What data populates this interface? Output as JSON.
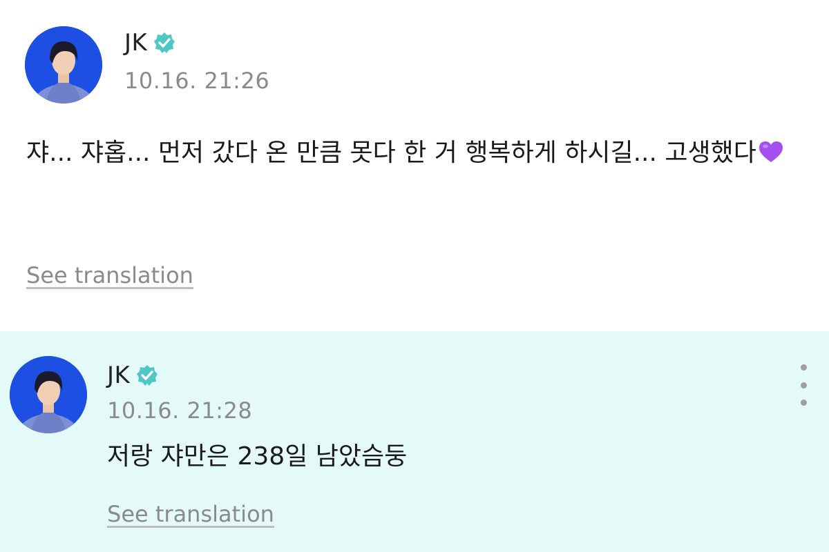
{
  "posts": [
    {
      "author": "JK",
      "timestamp": "10.16. 21:26",
      "text": "쟈... 쟈홉... 먼저 갔다 온 만큼 못다 한 거 행복하게 하시길... 고생했다",
      "emoji": "purple-heart",
      "see_translation": "See translation"
    },
    {
      "author": "JK",
      "timestamp": "10.16. 21:28",
      "text": "저랑 쟈만은 238일 남았슴둥",
      "see_translation": "See translation"
    }
  ],
  "colors": {
    "verified_badge": "#4fc7c9",
    "highlight_bg": "#e3faf8",
    "avatar_bg": "#1f52e8",
    "heart": "#a64ff0"
  },
  "icons": [
    "verified-badge-icon",
    "purple-heart-icon",
    "more-options-icon"
  ]
}
